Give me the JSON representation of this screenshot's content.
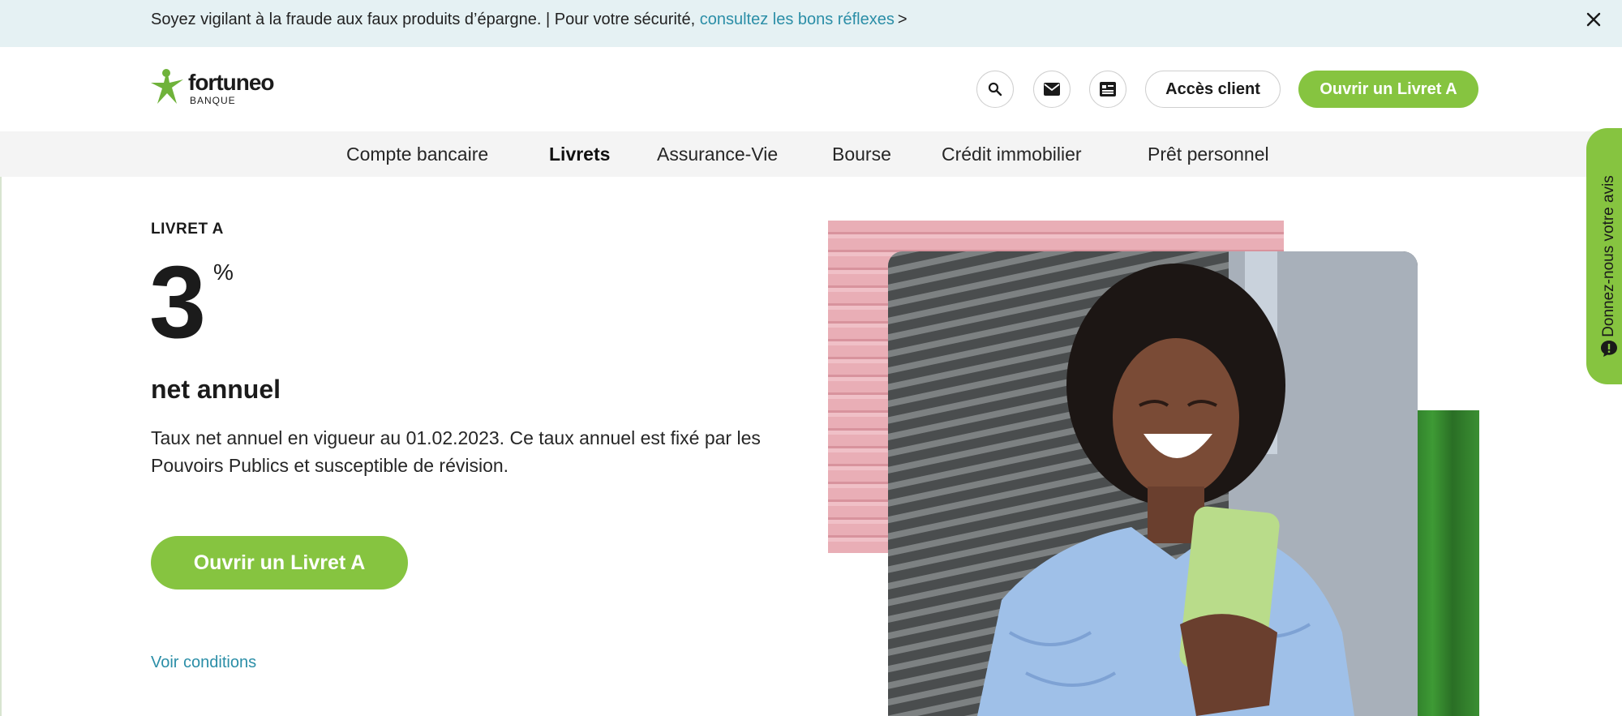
{
  "banner": {
    "text": "Soyez vigilant à la fraude aux faux produits d’épargne. | Pour votre sécurité, ",
    "link_label": "consultez les bons réflexes",
    "arrow": ">",
    "close_icon": "close-icon"
  },
  "header": {
    "logo_name": "fortuneo",
    "logo_sub": "BANQUE",
    "icons": [
      "search-icon",
      "mail-icon",
      "contact-card-icon"
    ],
    "client_button": "Accès client",
    "open_button": "Ouvrir un Livret A"
  },
  "nav": {
    "items": [
      {
        "label": "Compte bancaire",
        "active": false
      },
      {
        "label": "Livrets",
        "active": true
      },
      {
        "label": "Assurance-Vie",
        "active": false
      },
      {
        "label": "Bourse",
        "active": false
      },
      {
        "label": "Crédit immobilier",
        "active": false
      },
      {
        "label": "Prêt personnel",
        "active": false
      }
    ]
  },
  "hero": {
    "eyebrow": "LIVRET A",
    "rate": "3",
    "rate_unit": "%",
    "rate_label": "net annuel",
    "description": "Taux net annuel en vigueur au 01.02.2023. Ce taux annuel est fixé par les Pouvoirs Publics et susceptible de révision.",
    "cta": "Ouvrir un Livret A",
    "conditions_link": "Voir conditions"
  },
  "feedback": {
    "label": "Donnez-nous votre avis",
    "icon": "chat-bubble-icon"
  },
  "colors": {
    "brand_green": "#86c440",
    "link_blue": "#2b8ea7",
    "banner_bg": "#e5f1f3",
    "nav_bg": "#f4f4f4"
  }
}
